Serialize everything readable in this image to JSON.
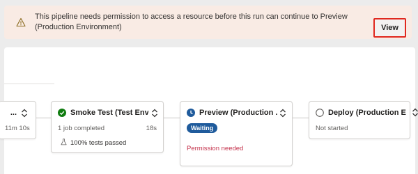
{
  "banner": {
    "message": "This pipeline needs permission to access a resource before this run can continue to Preview (Production Environment)",
    "view_label": "View",
    "icon": "warning-icon"
  },
  "stages": [
    {
      "title": "...",
      "duration": "11m 10s",
      "status": "succeeded"
    },
    {
      "title": "Smoke Test (Test Envi...",
      "jobs": "1 job completed",
      "duration": "18s",
      "tests": "100% tests passed",
      "status": "succeeded"
    },
    {
      "title": "Preview (Production ...",
      "badge": "Waiting",
      "note": "Permission needed",
      "status": "waiting"
    },
    {
      "title": "Deploy (Production E...",
      "state": "Not started",
      "status": "not-started"
    }
  ],
  "colors": {
    "success": "#107c10",
    "waiting": "#1f5b9c",
    "error": "#c4314b",
    "highlight": "#e0281e"
  }
}
